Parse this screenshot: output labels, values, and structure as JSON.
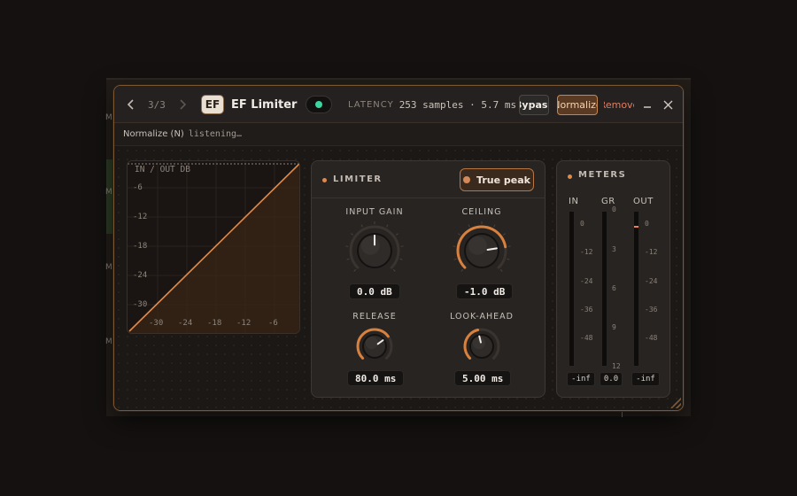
{
  "host": {
    "side_marks": [
      "M",
      "M",
      "M",
      "M",
      "M"
    ]
  },
  "titlebar": {
    "prev_icon": "chevron-left-icon",
    "counter": "3/3",
    "next_icon": "chevron-right-icon",
    "logo_text": "EF",
    "plugin_name": "EF Limiter",
    "power_on": true,
    "latency_label": "LATENCY",
    "latency_value": "253 samples · 5.7 ms",
    "bypass_label": "Bypass",
    "normalize_label": "Normalize",
    "remove_label": "Remove",
    "minimize_icon": "minimize-icon",
    "close_icon": "close-icon"
  },
  "status": {
    "prefix": "Normalize (N)",
    "message": "listening…"
  },
  "graph": {
    "title": "IN / OUT DB",
    "y_ticks": [
      "-6",
      "-12",
      "-18",
      "-24",
      "-30"
    ],
    "x_ticks": [
      "-30",
      "-24",
      "-18",
      "-12",
      "-6"
    ]
  },
  "limiter": {
    "title": "LIMITER",
    "true_peak_label": "True peak",
    "true_peak_on": true,
    "input_gain": {
      "label": "INPUT GAIN",
      "value": "0.0 dB",
      "level": 0.5,
      "accent": false
    },
    "ceiling": {
      "label": "CEILING",
      "value": "-1.0 dB",
      "level": 0.8,
      "accent": true
    },
    "release": {
      "label": "RELEASE",
      "value": "80.0 ms",
      "level": 0.7,
      "accent": true
    },
    "lookahead": {
      "label": "LOOK-AHEAD",
      "value": "5.00 ms",
      "level": 0.45,
      "accent": true
    }
  },
  "meters": {
    "title": "METERS",
    "in_label": "IN",
    "gr_label": "GR",
    "out_label": "OUT",
    "db_ticks": [
      "0",
      "-12",
      "-24",
      "-36",
      "-48"
    ],
    "gr_ticks": [
      "0",
      "3",
      "6",
      "9",
      "12"
    ],
    "in_readout": "-inf",
    "gr_readout": "0.0",
    "out_readout": "-inf",
    "out_peak_level": 0.91
  },
  "colors": {
    "accent": "#e08a4a",
    "arc_accent": "#d8813f",
    "arc_track": "#3a3430",
    "power_led": "#3ad6a0",
    "remove_text": "#e27d62"
  }
}
